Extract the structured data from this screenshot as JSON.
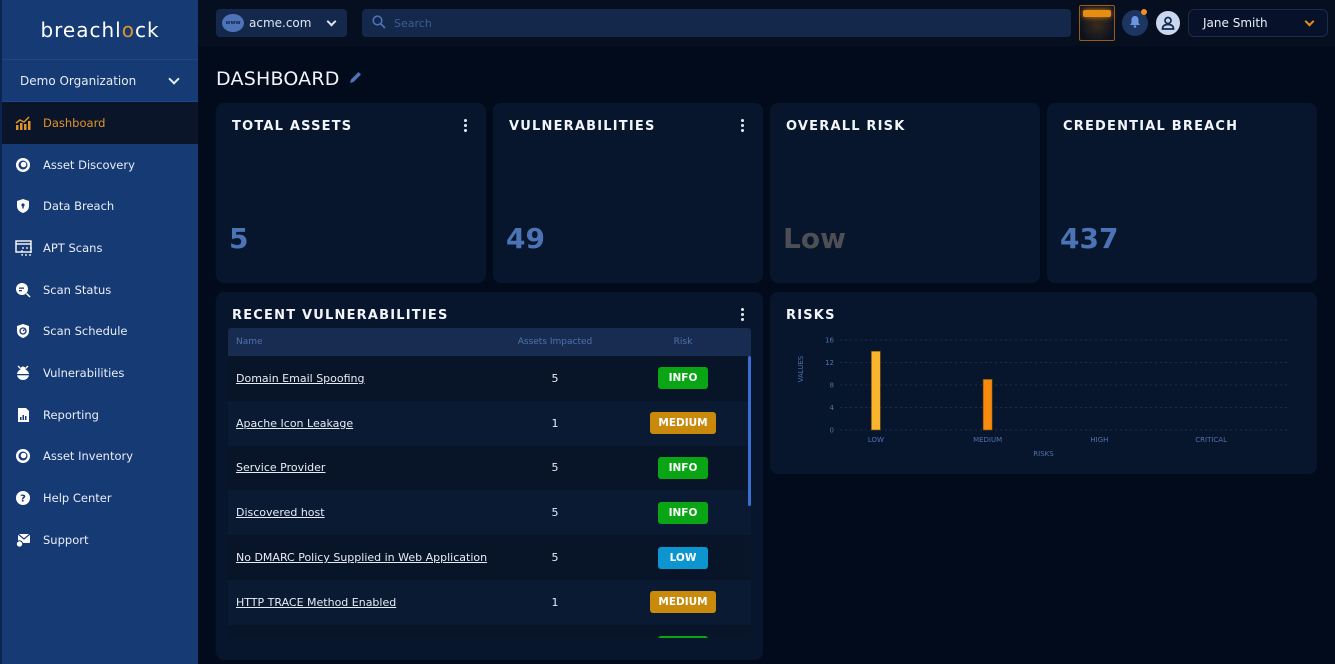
{
  "brand": {
    "name_pre": "breachl",
    "name_o": "o",
    "name_post": "ck"
  },
  "org_selector": {
    "label": "Demo Organization"
  },
  "sidebar": {
    "items": [
      {
        "label": "Dashboard",
        "icon": "chart-growth-icon",
        "active": true
      },
      {
        "label": "Asset Discovery",
        "icon": "target-icon"
      },
      {
        "label": "Data Breach",
        "icon": "shield-lock-icon"
      },
      {
        "label": "APT Scans",
        "icon": "scan-window-icon"
      },
      {
        "label": "Scan Status",
        "icon": "search-status-icon"
      },
      {
        "label": "Scan Schedule",
        "icon": "shield-clock-icon"
      },
      {
        "label": "Vulnerabilities",
        "icon": "bug-icon"
      },
      {
        "label": "Reporting",
        "icon": "report-icon"
      },
      {
        "label": "Asset Inventory",
        "icon": "target-icon"
      },
      {
        "label": "Help Center",
        "icon": "question-icon"
      },
      {
        "label": "Support",
        "icon": "support-icon"
      }
    ]
  },
  "topbar": {
    "domain": "acme.com",
    "domain_icon_text": "www",
    "search_placeholder": "Search",
    "user_name": "Jane Smith"
  },
  "page": {
    "title": "DASHBOARD"
  },
  "cards": {
    "total_assets": {
      "title": "TOTAL ASSETS",
      "value": "5"
    },
    "vulnerabilities": {
      "title": "VULNERABILITIES",
      "value": "49"
    },
    "overall_risk": {
      "title": "OVERALL RISK",
      "value": "Low"
    },
    "credential_breach": {
      "title": "CREDENTIAL BREACH",
      "value": "437"
    }
  },
  "recent_vulnerabilities": {
    "title": "RECENT VULNERABILITIES",
    "columns": [
      "Name",
      "Assets Impacted",
      "Risk"
    ],
    "rows": [
      {
        "name": "Domain Email Spoofing",
        "assets": "5",
        "risk": "INFO"
      },
      {
        "name": "Apache Icon Leakage",
        "assets": "1",
        "risk": "MEDIUM"
      },
      {
        "name": "Service Provider",
        "assets": "5",
        "risk": "INFO"
      },
      {
        "name": "Discovered host",
        "assets": "5",
        "risk": "INFO"
      },
      {
        "name": "No DMARC Policy Supplied in Web Application ",
        "assets": "5",
        "risk": "LOW"
      },
      {
        "name": "HTTP TRACE Method Enabled",
        "assets": "1",
        "risk": "MEDIUM"
      },
      {
        "name": "",
        "assets": "",
        "risk": "INFO"
      }
    ],
    "risk_colors": {
      "INFO": "#0aa514",
      "MEDIUM": "#c98a0c",
      "LOW": "#0c95cf"
    }
  },
  "chart_data": {
    "type": "bar",
    "title": "RISKS",
    "categories": [
      "LOW",
      "MEDIUM",
      "HIGH",
      "CRITICAL"
    ],
    "values": [
      14,
      9,
      0,
      0
    ],
    "colors": [
      "#fbb52c",
      "#f98c0e",
      "#f05a28",
      "#d7261e"
    ],
    "xlabel": "RISKS",
    "ylabel": "VALUES",
    "ylim": [
      0,
      16
    ],
    "yticks": [
      0,
      4,
      8,
      12,
      16
    ],
    "grid": true
  }
}
